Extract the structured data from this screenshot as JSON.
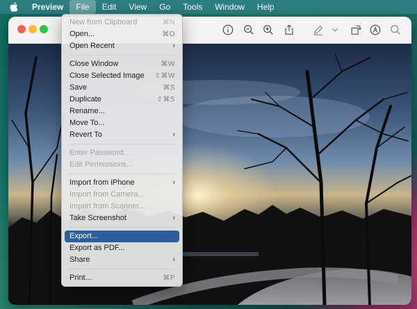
{
  "menubar": {
    "items": [
      {
        "label": "Preview"
      },
      {
        "label": "File"
      },
      {
        "label": "Edit"
      },
      {
        "label": "View"
      },
      {
        "label": "Go"
      },
      {
        "label": "Tools"
      },
      {
        "label": "Window"
      },
      {
        "label": "Help"
      }
    ]
  },
  "file_menu": {
    "new_clipboard": {
      "label": "New from Clipboard",
      "shortcut": "⌘N"
    },
    "open": {
      "label": "Open...",
      "shortcut": "⌘O"
    },
    "open_recent": {
      "label": "Open Recent"
    },
    "close_window": {
      "label": "Close Window",
      "shortcut": "⌘W"
    },
    "close_selected": {
      "label": "Close Selected Image",
      "shortcut": "⇧⌘W"
    },
    "save": {
      "label": "Save",
      "shortcut": "⌘S"
    },
    "duplicate": {
      "label": "Duplicate",
      "shortcut": "⇧⌘S"
    },
    "rename": {
      "label": "Rename..."
    },
    "move_to": {
      "label": "Move To..."
    },
    "revert_to": {
      "label": "Revert To"
    },
    "enter_password": {
      "label": "Enter Password..."
    },
    "edit_permissions": {
      "label": "Edit Permissions..."
    },
    "import_iphone": {
      "label": "Import from iPhone"
    },
    "import_camera": {
      "label": "Import from Camera..."
    },
    "import_scanner": {
      "label": "Import from Scanner..."
    },
    "take_screenshot": {
      "label": "Take Screenshot"
    },
    "export": {
      "label": "Export..."
    },
    "export_pdf": {
      "label": "Export as PDF..."
    },
    "share": {
      "label": "Share"
    },
    "print": {
      "label": "Print...",
      "shortcut": "⌘P"
    }
  },
  "colors": {
    "menubar": "#2b7f80",
    "highlight": "#2d5f9e",
    "close": "#ff5f57",
    "minimize": "#febc2e",
    "zoom": "#28c840"
  }
}
